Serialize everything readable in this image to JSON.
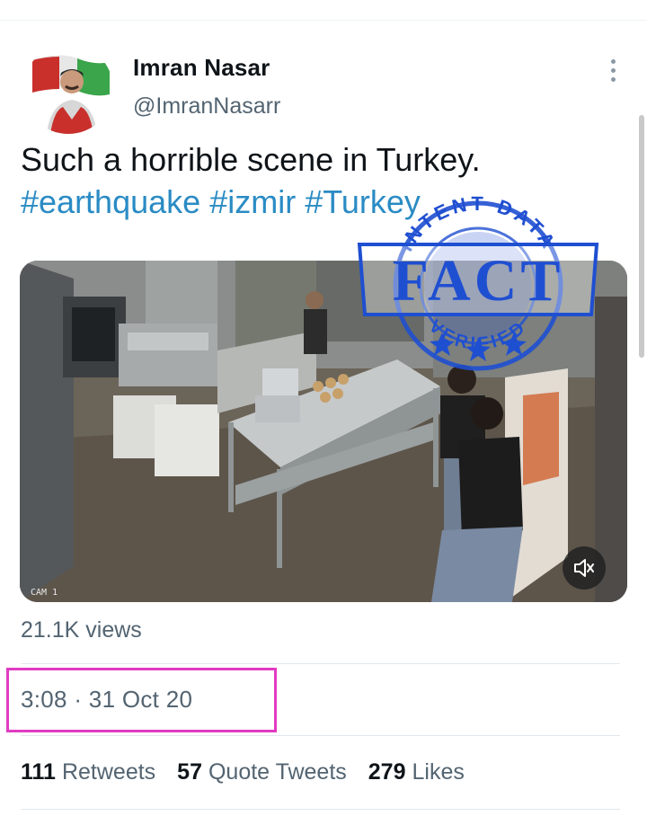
{
  "author": {
    "display_name": "Imran Nasar",
    "handle": "@ImranNasarr"
  },
  "tweet": {
    "text_plain": "Such a horrible scene in Turkey.",
    "hashtags": [
      "#earthquake",
      "#izmir",
      "#Turkey"
    ]
  },
  "media": {
    "type": "video",
    "mute_icon": "speaker-muted-icon",
    "camera_label": "CAM 1",
    "watermark": {
      "top_text": "INTENT DATA",
      "main_text": "FACT",
      "bottom_text": "VERIFIED"
    }
  },
  "views": {
    "count": "21.1K",
    "label": "views"
  },
  "timestamp": "3:08 · 31 Oct 20",
  "stats": [
    {
      "count": "111",
      "label": "Retweets"
    },
    {
      "count": "57",
      "label": "Quote Tweets"
    },
    {
      "count": "279",
      "label": "Likes"
    }
  ],
  "colors": {
    "hashtag": "#2a8bc4",
    "highlight_box": "#e23bc2",
    "stamp_blue": "#1f4fd1",
    "secondary_text": "#536471"
  }
}
